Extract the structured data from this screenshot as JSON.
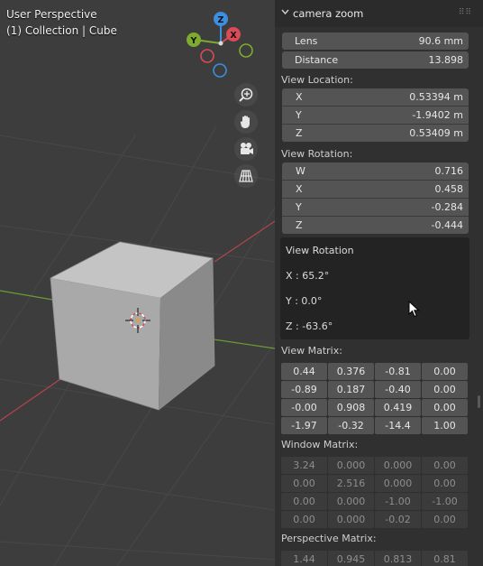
{
  "viewport": {
    "line1": "User Perspective",
    "line2": "(1) Collection | Cube",
    "gizmo": {
      "z": "Z",
      "y": "Y",
      "x": "X"
    },
    "nav_icons": [
      "zoom-icon",
      "hand-pan-icon",
      "camera-icon",
      "grid-perspective-icon"
    ]
  },
  "panel": {
    "title": "camera zoom",
    "lens": {
      "label": "Lens",
      "value": "90.6 mm"
    },
    "distance": {
      "label": "Distance",
      "value": "13.898"
    },
    "view_location": {
      "label": "View Location:",
      "rows": [
        {
          "label": "X",
          "value": "0.53394 m"
        },
        {
          "label": "Y",
          "value": "-1.9402 m"
        },
        {
          "label": "Z",
          "value": "0.53409 m"
        }
      ]
    },
    "view_rotation": {
      "label": "View Rotation:",
      "rows": [
        {
          "label": "W",
          "value": "0.716"
        },
        {
          "label": "X",
          "value": "0.458"
        },
        {
          "label": "Y",
          "value": "-0.284"
        },
        {
          "label": "Z",
          "value": "-0.444"
        }
      ]
    },
    "rotation_box": {
      "title": "View Rotation",
      "x": "X : 65.2°",
      "y": "Y : 0.0°",
      "z": "Z : -63.6°"
    },
    "view_matrix": {
      "label": "View Matrix:",
      "rows": [
        [
          "0.44",
          "0.376",
          "-0.81",
          "0.00"
        ],
        [
          "-0.89",
          "0.187",
          "-0.40",
          "0.00"
        ],
        [
          "-0.00",
          "0.908",
          "0.419",
          "0.00"
        ],
        [
          "-1.97",
          "-0.32",
          "-14.4",
          "1.00"
        ]
      ]
    },
    "window_matrix": {
      "label": "Window Matrix:",
      "rows": [
        [
          "3.24",
          "0.000",
          "0.000",
          "0.00"
        ],
        [
          "0.00",
          "2.516",
          "0.000",
          "0.00"
        ],
        [
          "0.00",
          "0.000",
          "-1.00",
          "-1.00"
        ],
        [
          "0.00",
          "0.000",
          "-0.02",
          "0.00"
        ]
      ]
    },
    "perspective_matrix": {
      "label": "Perspective Matrix:",
      "rows": [
        [
          "1.44",
          "0.945",
          "0.813",
          "0.81"
        ]
      ]
    }
  },
  "colors": {
    "axis_x": "#d94b55",
    "axis_y": "#7dab2f",
    "axis_z": "#3b8ee0",
    "field": "#545454",
    "panel_bg": "#303030"
  }
}
